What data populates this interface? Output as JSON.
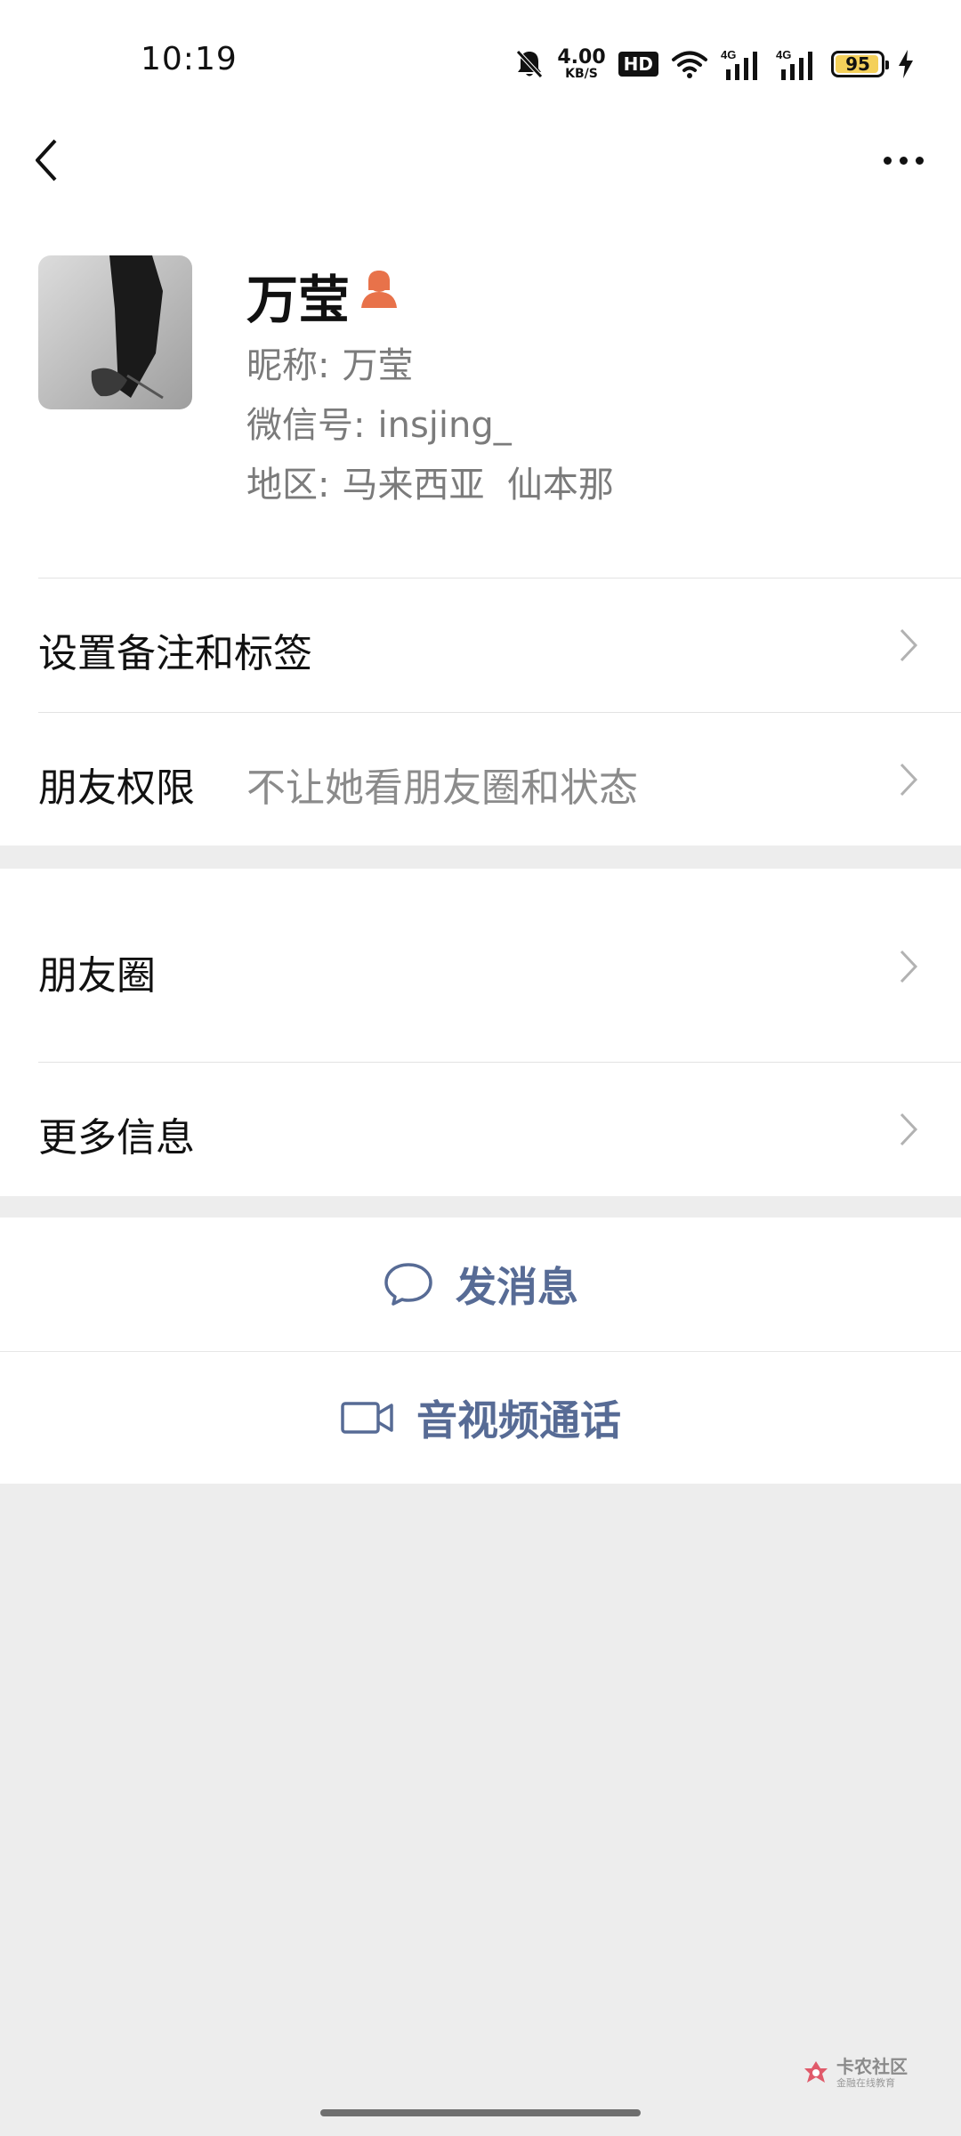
{
  "status_bar": {
    "time": "10:19",
    "net_speed_value": "4.00",
    "net_speed_unit": "KB/S",
    "hd_label": "HD",
    "signal1_label": "4G",
    "signal2_label": "4G",
    "battery_level": "95",
    "icons": [
      "mute-bell-icon",
      "wifi-icon",
      "signal-icon",
      "signal-icon",
      "battery-icon",
      "charging-icon"
    ]
  },
  "nav": {
    "back_icon": "chevron-left-icon",
    "more_icon": "more-dots-icon"
  },
  "profile": {
    "name": "万莹",
    "gender_icon": "female-icon",
    "nickname_label": "昵称:",
    "nickname": "万莹",
    "wechat_id_label": "微信号:",
    "wechat_id": "insjing_",
    "region_label": "地区:",
    "region": "马来西亚  仙本那"
  },
  "rows": [
    {
      "label": "设置备注和标签",
      "value": ""
    },
    {
      "label": "朋友权限",
      "value": "不让她看朋友圈和状态"
    },
    {
      "label": "朋友圈",
      "value": ""
    },
    {
      "label": "更多信息",
      "value": ""
    }
  ],
  "actions": {
    "message": {
      "label": "发消息",
      "icon": "chat-bubble-icon"
    },
    "call": {
      "label": "音视频通话",
      "icon": "video-camera-icon"
    }
  },
  "watermark": {
    "title": "卡农社区",
    "subtitle": "金融在线教育"
  },
  "colors": {
    "link": "#576b95",
    "gender": "#e8724a",
    "background": "#ededed"
  }
}
